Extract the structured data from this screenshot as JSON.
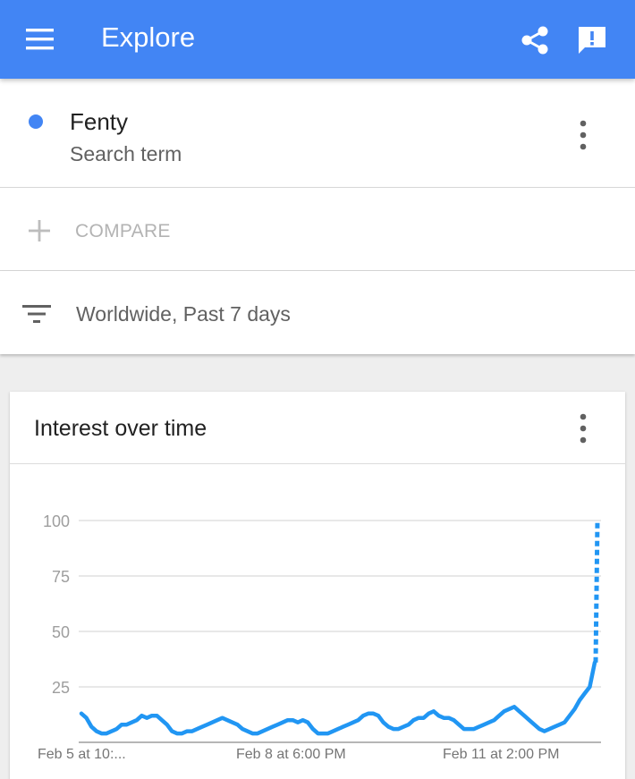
{
  "appbar": {
    "title": "Explore",
    "color": "#4285f4",
    "icons": [
      "menu-icon",
      "share-icon",
      "feedback-icon"
    ]
  },
  "search_term": {
    "name": "Fenty",
    "type_label": "Search term",
    "dot_color": "#4285f4"
  },
  "compare": {
    "label": "COMPARE"
  },
  "filter": {
    "label": "Worldwide, Past 7 days"
  },
  "interest_card": {
    "title": "Interest over time"
  },
  "chart_data": {
    "type": "line",
    "title": "Interest over time",
    "xlabel": "",
    "ylabel": "",
    "ylim": [
      0,
      100
    ],
    "yticks": [
      25,
      50,
      75,
      100
    ],
    "xtick_labels": [
      "Feb 5 at 10:...",
      "Feb 8 at 6:00 PM",
      "Feb 11 at 2:00 PM"
    ],
    "grid": true,
    "line_color": "#2196f3",
    "series": [
      {
        "values": [
          13,
          11,
          7,
          5,
          4,
          4,
          5,
          6,
          8,
          8,
          9,
          10,
          12,
          11,
          12,
          12,
          10,
          8,
          5,
          4,
          4,
          5,
          5,
          6,
          7,
          8,
          9,
          10,
          11,
          10,
          9,
          8,
          6,
          5,
          4,
          4,
          5,
          6,
          7,
          8,
          9,
          10,
          10,
          9,
          10,
          9,
          6,
          4,
          4,
          4,
          5,
          6,
          7,
          8,
          9,
          10,
          12,
          13,
          13,
          12,
          9,
          7,
          6,
          6,
          7,
          8,
          10,
          11,
          11,
          13,
          14,
          12,
          11,
          11,
          10,
          8,
          6,
          6,
          6,
          7,
          8,
          9,
          10,
          12,
          14,
          15,
          16,
          14,
          12,
          10,
          8,
          6,
          5,
          6,
          7,
          8,
          9,
          12,
          15,
          19,
          22,
          25,
          36
        ],
        "projection": [
          36,
          100
        ]
      }
    ]
  }
}
